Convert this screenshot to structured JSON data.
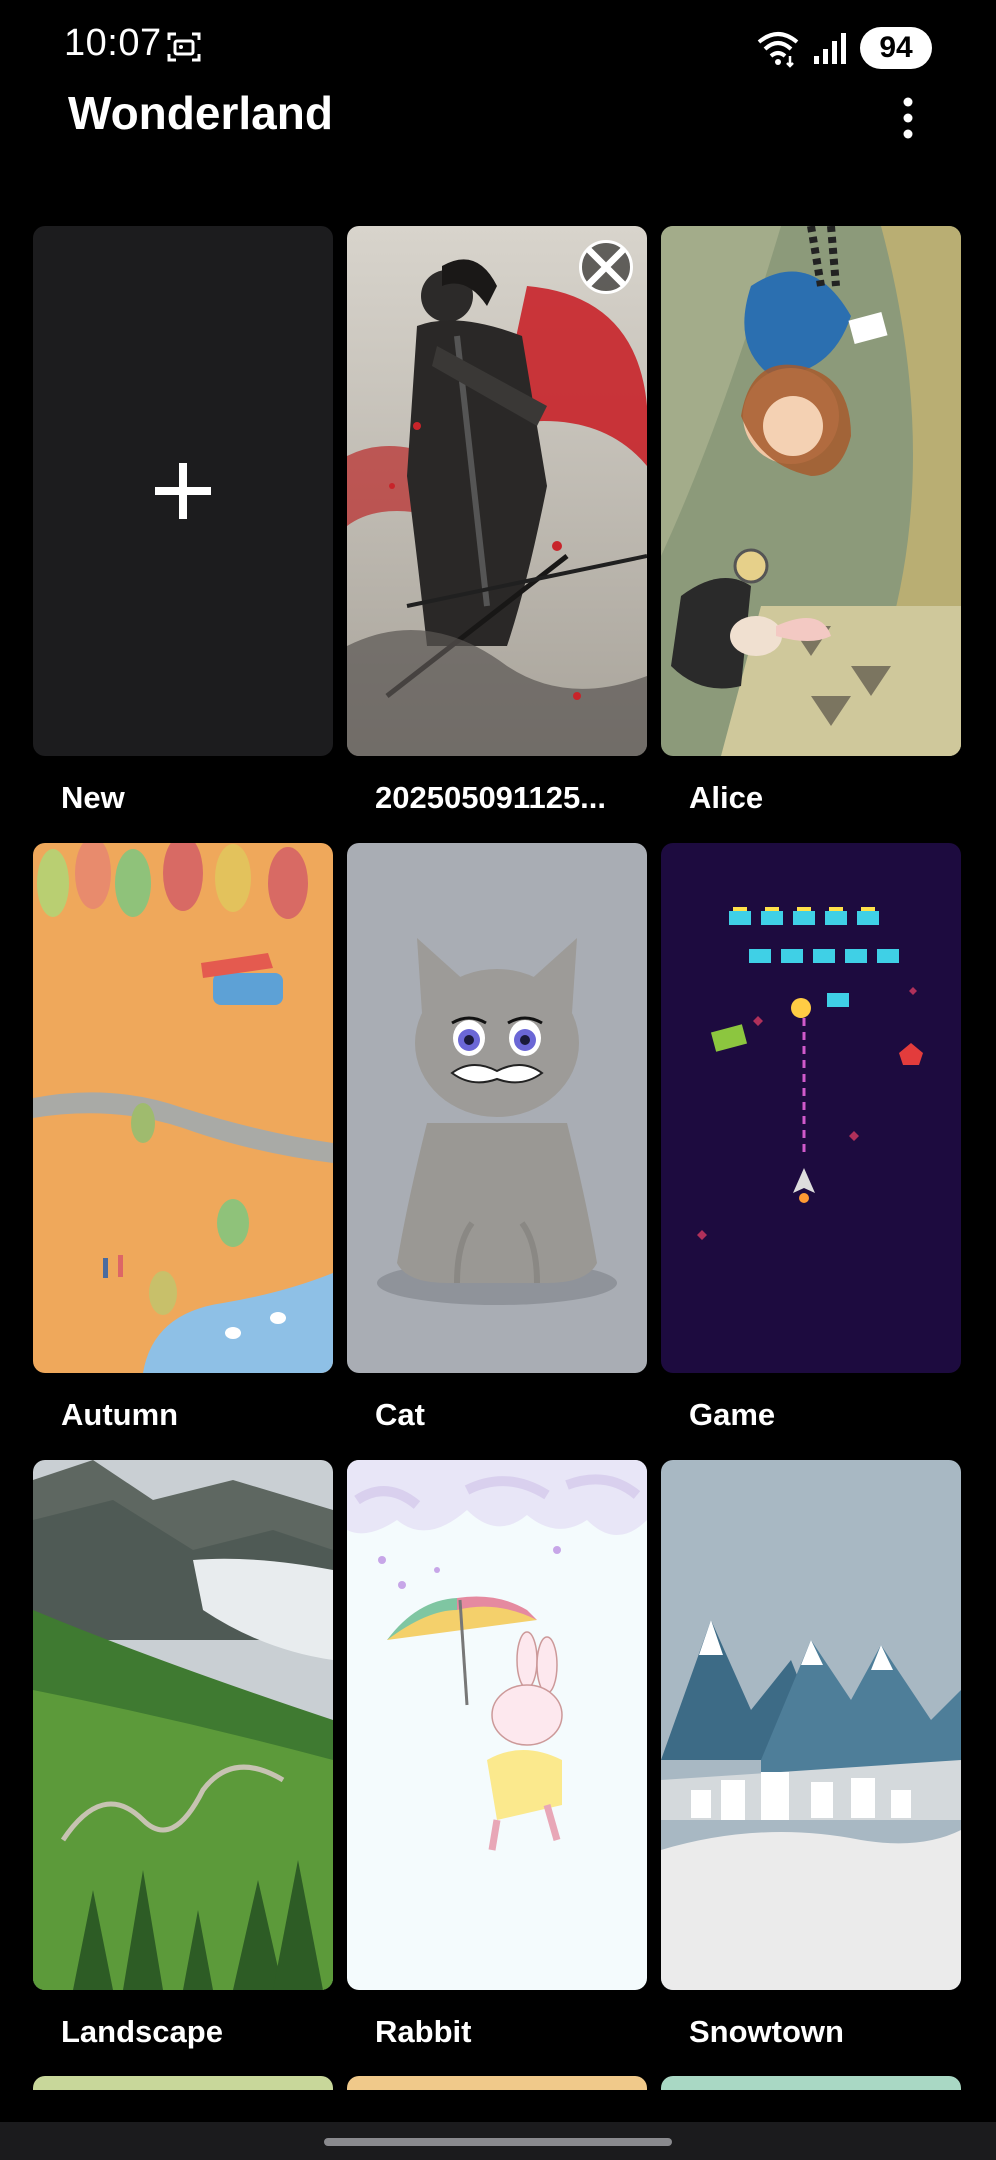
{
  "status_bar": {
    "time": "10:07",
    "battery": "94",
    "icons": [
      "screenshot-icon",
      "wifi-icon",
      "signal-icon"
    ]
  },
  "app_bar": {
    "title": "Wonderland",
    "menu_icon": "more-vertical-icon"
  },
  "tiles": [
    {
      "label": "New",
      "type": "add",
      "icon": "plus-icon"
    },
    {
      "label": "202505091125...",
      "type": "image",
      "art": "samurai",
      "has_delete": true
    },
    {
      "label": "Alice",
      "type": "image",
      "art": "alice"
    },
    {
      "label": "Autumn",
      "type": "image",
      "art": "autumn"
    },
    {
      "label": "Cat",
      "type": "image",
      "art": "cat"
    },
    {
      "label": "Game",
      "type": "image",
      "art": "game"
    },
    {
      "label": "Landscape",
      "type": "image",
      "art": "landscape"
    },
    {
      "label": "Rabbit",
      "type": "image",
      "art": "rabbit"
    },
    {
      "label": "Snowtown",
      "type": "image",
      "art": "snowtown"
    }
  ],
  "colors": {
    "background": "#000000",
    "tile_new_bg": "#1c1c1e",
    "text": "#ffffff",
    "nav_bar": "#1b1b1d"
  }
}
